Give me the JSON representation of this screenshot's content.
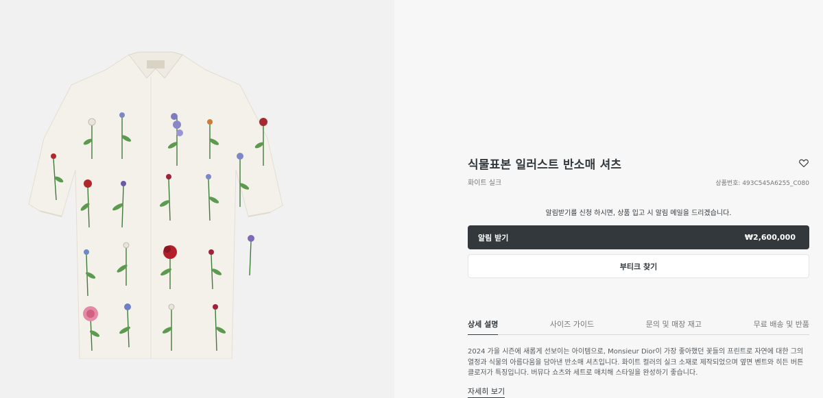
{
  "product": {
    "title": "식물표본 일러스트 반소매 셔츠",
    "material": "화이트 실크",
    "code": "상품번호: 493C545A6255_C080",
    "image_alt": "floral-print-shirt-image"
  },
  "notify": {
    "message": "알림받기를 신청 하시면, 상품 입고 시 알림 메일을 드리겠습니다.",
    "button_label": "알림 받기",
    "price": "₩2,600,000"
  },
  "boutique": {
    "button_label": "부티크 찾기"
  },
  "tabs": [
    {
      "label": "상세 설명",
      "active": true
    },
    {
      "label": "사이즈 가이드",
      "active": false
    },
    {
      "label": "문의 및 매장 재고",
      "active": false
    },
    {
      "label": "무료 배송 및 반품",
      "active": false
    }
  ],
  "description": {
    "text": "2024 가을 시즌에 새롭게 선보이는 아이템으로, Monsieur Dior이 가장 좋아했던 꽃들의 프린트로 자연에 대한 그의 열정과 식물의 아름다움을 담아낸 반소매 셔츠입니다. 화이트 컬러의 실크 소재로 제작되었으며 옆면 벤트와 히든 버튼 클로저가 특징입니다. 버뮤다 쇼츠와 세트로 매치해 스타일을 완성하기 좋습니다.",
    "more_label": "자세히 보기"
  },
  "icons": {
    "wishlist": "heart-outline-icon"
  },
  "colors": {
    "image_bg": "#f1f1f1",
    "panel_bg": "#f7f7f7",
    "primary_button": "#33383c",
    "text": "#33383c"
  }
}
